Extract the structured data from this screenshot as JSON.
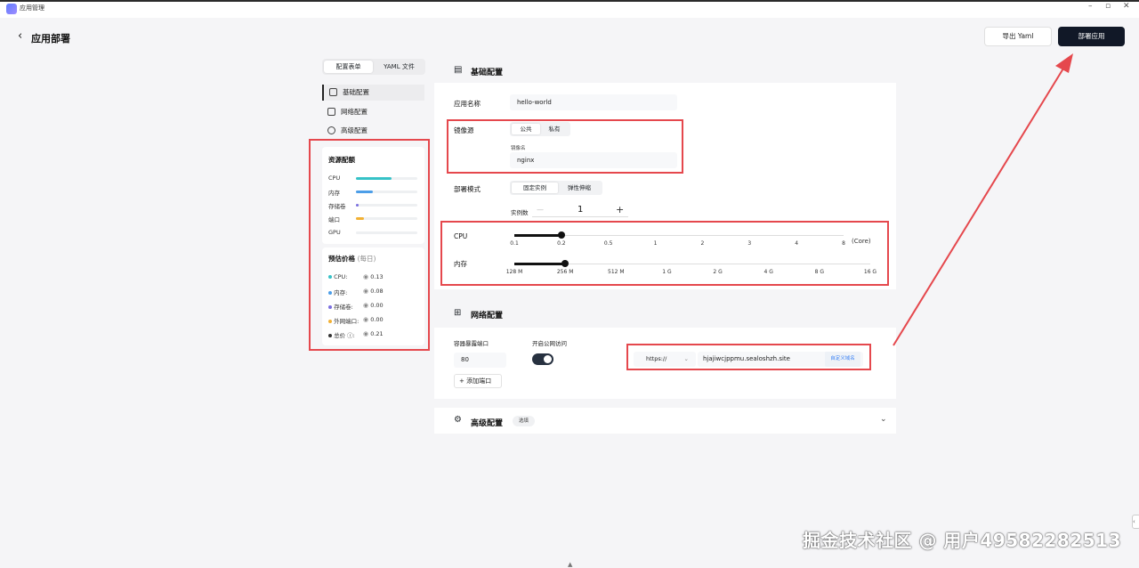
{
  "window": {
    "app_title": "应用管理"
  },
  "header": {
    "back_icon": "chevron-left-icon",
    "title": "应用部署",
    "export_label": "导出 Yaml",
    "deploy_label": "部署应用"
  },
  "side": {
    "tabs": [
      "配置表单",
      "YAML 文件"
    ],
    "nav": [
      "基础配置",
      "网络配置",
      "高级配置"
    ],
    "quota_title": "资源配额",
    "quota": [
      {
        "label": "CPU",
        "level": 0.58,
        "color": "#36c2c7"
      },
      {
        "label": "内存",
        "level": 0.28,
        "color": "#4c9ee8"
      },
      {
        "label": "存储卷",
        "level": 0.05,
        "color": "#7b6fe0"
      },
      {
        "label": "端口",
        "level": 0.13,
        "color": "#f2b134"
      },
      {
        "label": "GPU",
        "level": 0.0,
        "color": "#cccccc"
      }
    ],
    "price_title": "预估价格",
    "price_sub": "(每日)",
    "prices": [
      {
        "label": "CPU:",
        "value": "0.13",
        "color": "#36c2c7"
      },
      {
        "label": "内存:",
        "value": "0.08",
        "color": "#4c9ee8"
      },
      {
        "label": "存储卷:",
        "value": "0.00",
        "color": "#7b6fe0"
      },
      {
        "label": "外网端口:",
        "value": "0.00",
        "color": "#f2b134"
      },
      {
        "label": "总价 ⓘ:",
        "value": "0.21",
        "color": "#333333"
      }
    ]
  },
  "basic": {
    "title": "基础配置",
    "app_name_label": "应用名称",
    "app_name_value": "hello-world",
    "image_label": "镜像源",
    "image_tabs": [
      "公共",
      "私有"
    ],
    "image_name_label": "镜像名",
    "image_name_value": "nginx",
    "deploy_mode_label": "部署模式",
    "deploy_modes": [
      "固定实例",
      "弹性伸缩"
    ],
    "replicas_label": "实例数",
    "replicas_value": "1",
    "minus": "—",
    "plus": "+",
    "cpu_label": "CPU",
    "cpu_ticks": [
      "0.1",
      "0.2",
      "0.5",
      "1",
      "2",
      "3",
      "4",
      "8"
    ],
    "cpu_unit": "(Core)",
    "cpu_selected": "0.2",
    "mem_label": "内存",
    "mem_ticks": [
      "128 M",
      "256 M",
      "512 M",
      "1 G",
      "2 G",
      "4 G",
      "8 G",
      "16 G"
    ],
    "mem_selected": "256 M"
  },
  "network": {
    "title": "网络配置",
    "port_label": "容器暴露端口",
    "port_value": "80",
    "public_label": "开启公网访问",
    "public_enabled": true,
    "protocol": "https://",
    "domain": "hjajiwcjppmu.sealoshzh.site",
    "custom_domain": "自定义域名",
    "add_port": "添加端口"
  },
  "advanced": {
    "title": "高级配置",
    "badge": "选填"
  },
  "watermark": "掘金技术社区 @ 用户4958228251​3"
}
